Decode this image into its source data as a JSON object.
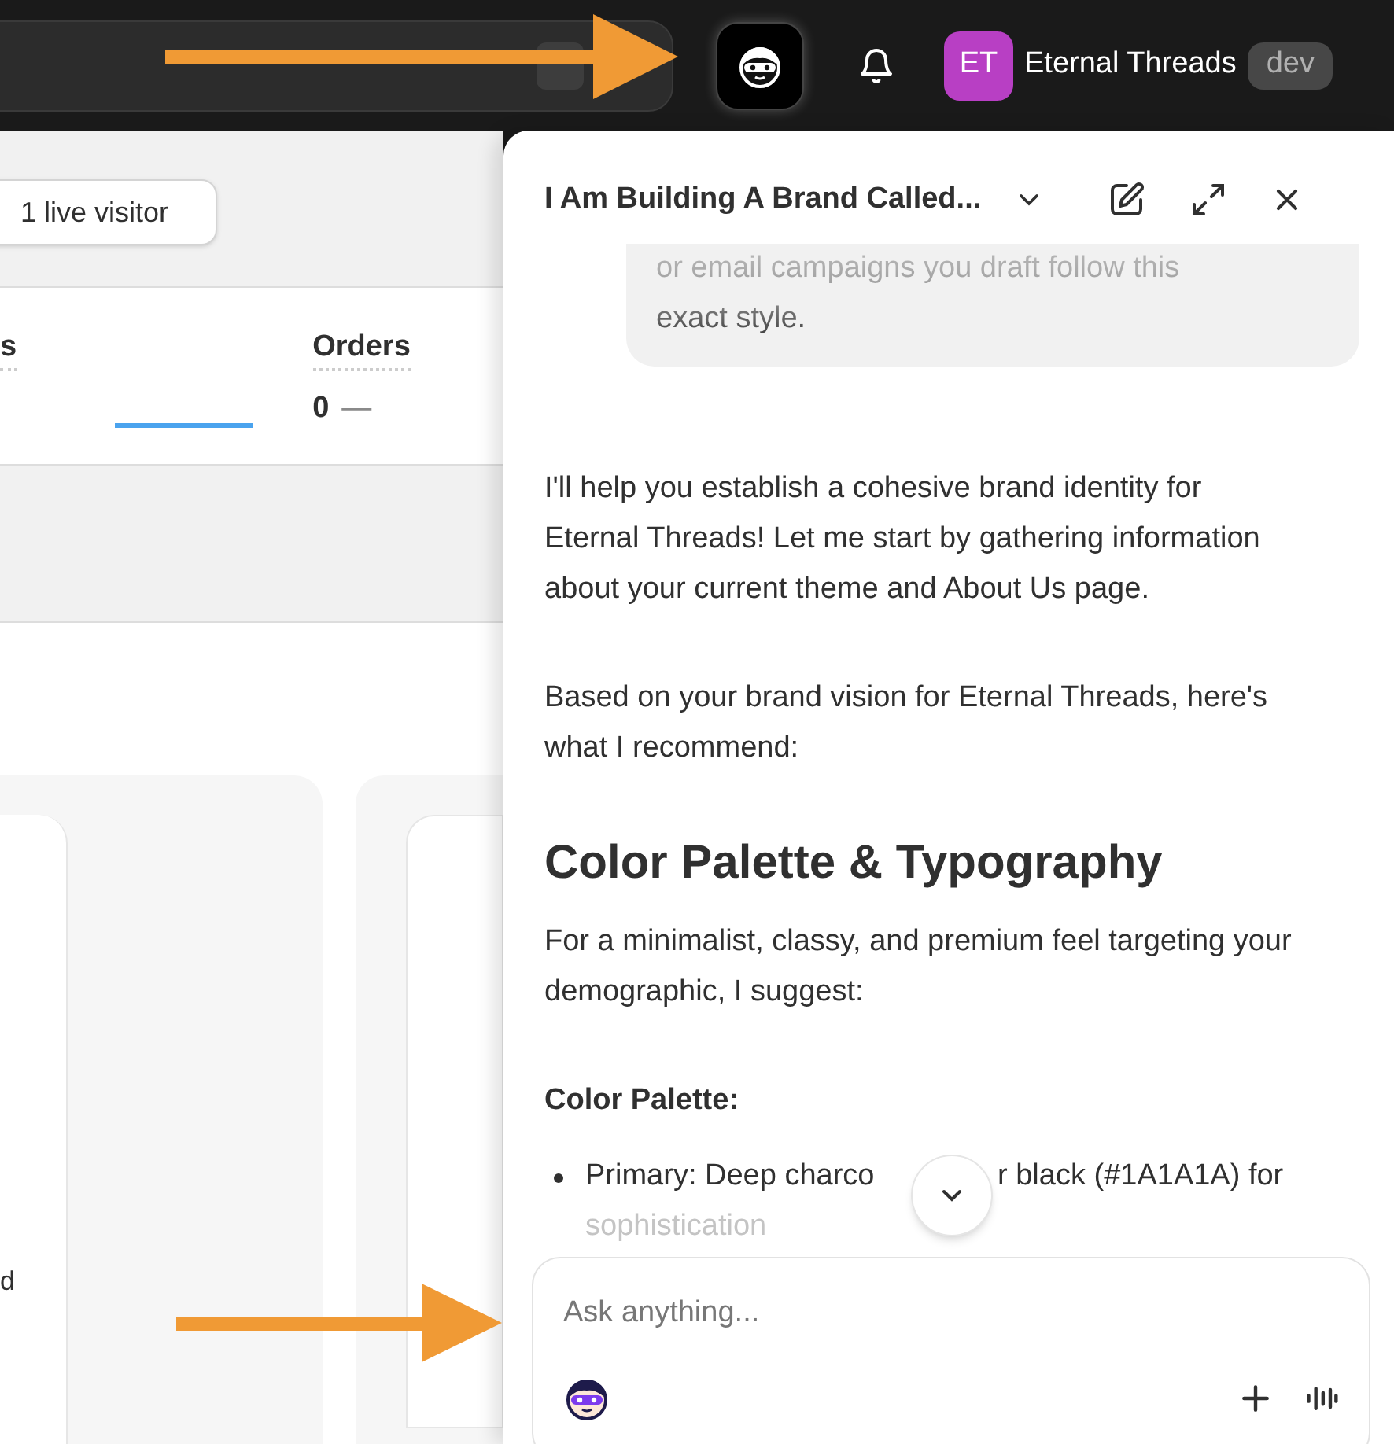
{
  "top_bar": {
    "user": {
      "initials": "ET",
      "name": "Eternal Threads",
      "badge": "dev"
    }
  },
  "dashboard": {
    "live_visitors": "1 live visitor",
    "metrics": [
      {
        "label": "s"
      },
      {
        "label": "Orders",
        "value": "0",
        "trend": "—"
      }
    ],
    "card_text": "d"
  },
  "chat": {
    "title": "I Am Building A Brand Called...",
    "user_message": "or email campaigns you draft follow this exact style.",
    "blocks": [
      {
        "kind": "paragraph",
        "text": "I'll help you establish a cohesive brand identity for Eternal Threads! Let me start by gathering information about your current theme and About Us page."
      },
      {
        "kind": "paragraph",
        "text": "Based on your brand vision for Eternal Threads, here's what I recommend:"
      },
      {
        "kind": "heading",
        "text": "Color Palette & Typography"
      },
      {
        "kind": "paragraph",
        "text": "For a minimalist, classy, and premium feel targeting your demographic, I suggest:"
      },
      {
        "kind": "label",
        "text": "Color Palette:"
      },
      {
        "kind": "bullet",
        "parts": [
          "Primary: Deep charco",
          "r black (#1A1A1A) for",
          "sophistication"
        ]
      }
    ],
    "composer": {
      "placeholder": "Ask anything..."
    }
  }
}
